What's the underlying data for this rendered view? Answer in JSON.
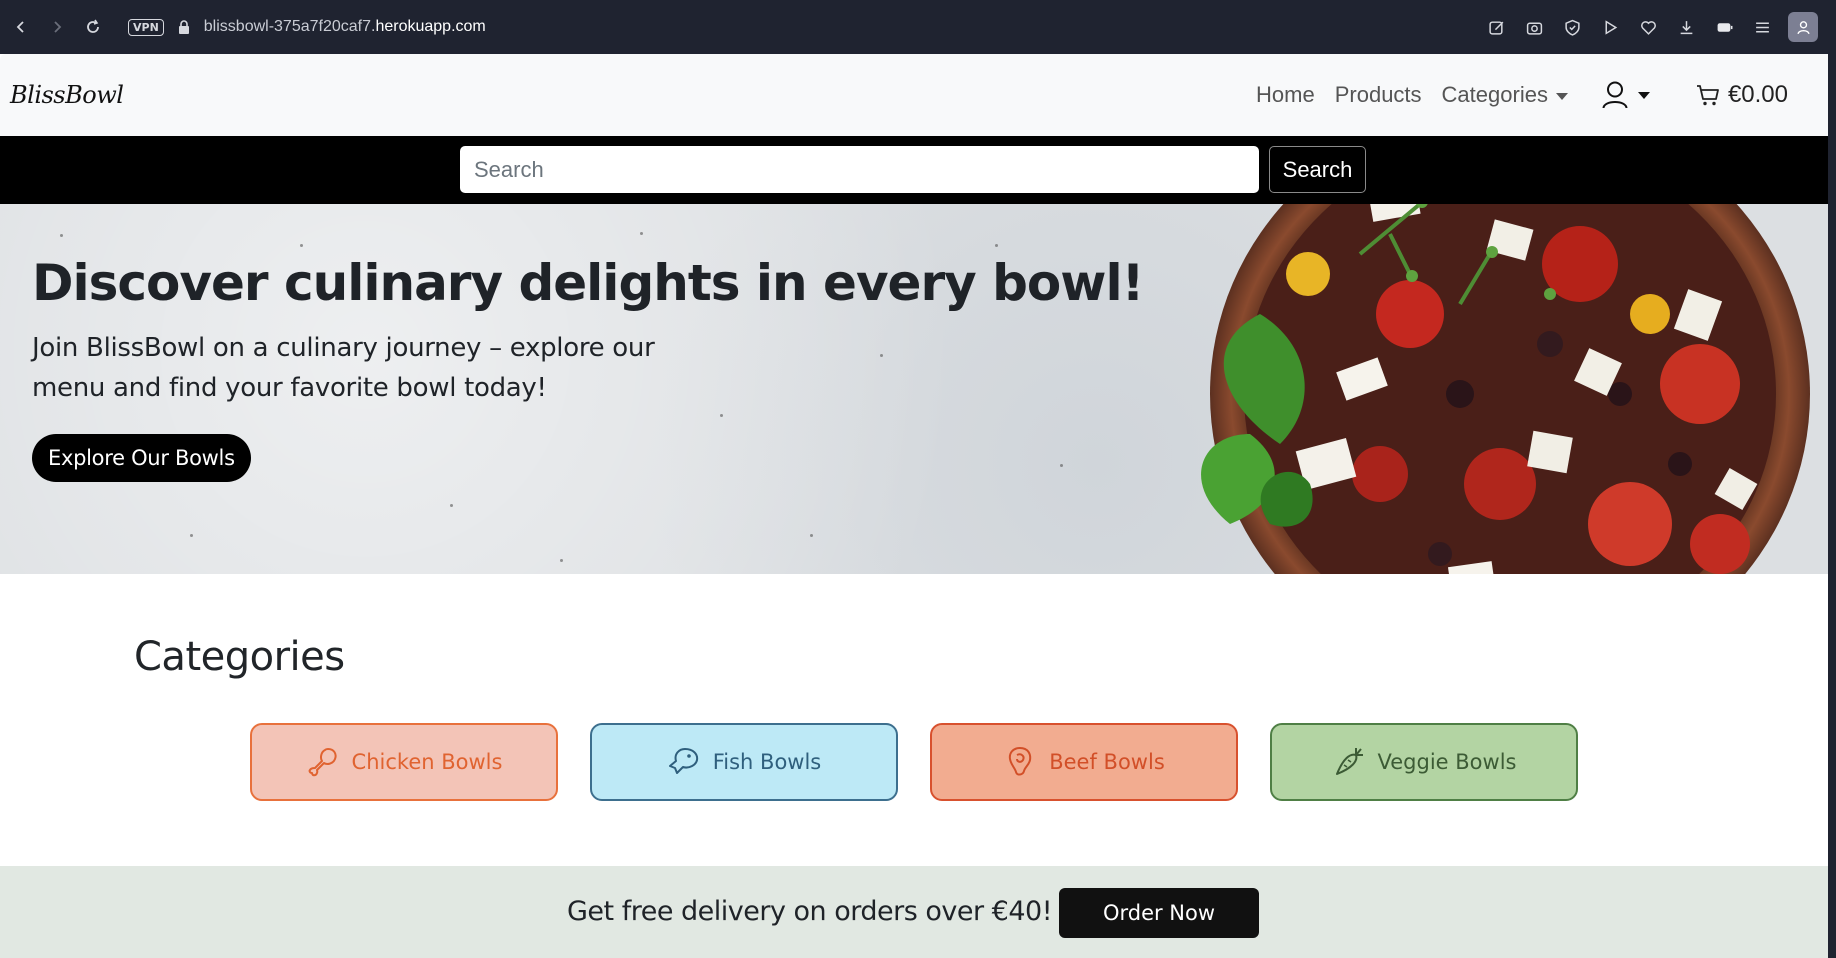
{
  "browser": {
    "url_prefix": "blissbowl-375a7f20caf7.",
    "url_domain": "herokuapp.com",
    "vpn_label": "VPN"
  },
  "header": {
    "logo": "BlissBowl",
    "nav": {
      "home": "Home",
      "products": "Products",
      "categories": "Categories"
    },
    "cart_total": "€0.00"
  },
  "search": {
    "placeholder": "Search",
    "button": "Search"
  },
  "hero": {
    "title": "Discover culinary delights in every bowl!",
    "subtitle": "Join BlissBowl on a culinary journey – explore our menu and find your favorite bowl today!",
    "cta": "Explore Our Bowls"
  },
  "categories": {
    "title": "Categories",
    "items": [
      {
        "label": "Chicken Bowls",
        "icon": "drumstick-icon",
        "bg": "#f3c4b7",
        "border": "#e8713c",
        "color": "#e06330"
      },
      {
        "label": "Fish Bowls",
        "icon": "fish-icon",
        "bg": "#bde9f6",
        "border": "#3d6f8e",
        "color": "#2f5f7d"
      },
      {
        "label": "Beef Bowls",
        "icon": "beef-icon",
        "bg": "#f2ac90",
        "border": "#d8512e",
        "color": "#d24f28"
      },
      {
        "label": "Veggie Bowls",
        "icon": "carrot-icon",
        "bg": "#b3d4a3",
        "border": "#4f7f45",
        "color": "#3c5b35"
      }
    ]
  },
  "promo": {
    "text": "Get free delivery on orders over €40!",
    "button": "Order Now"
  }
}
